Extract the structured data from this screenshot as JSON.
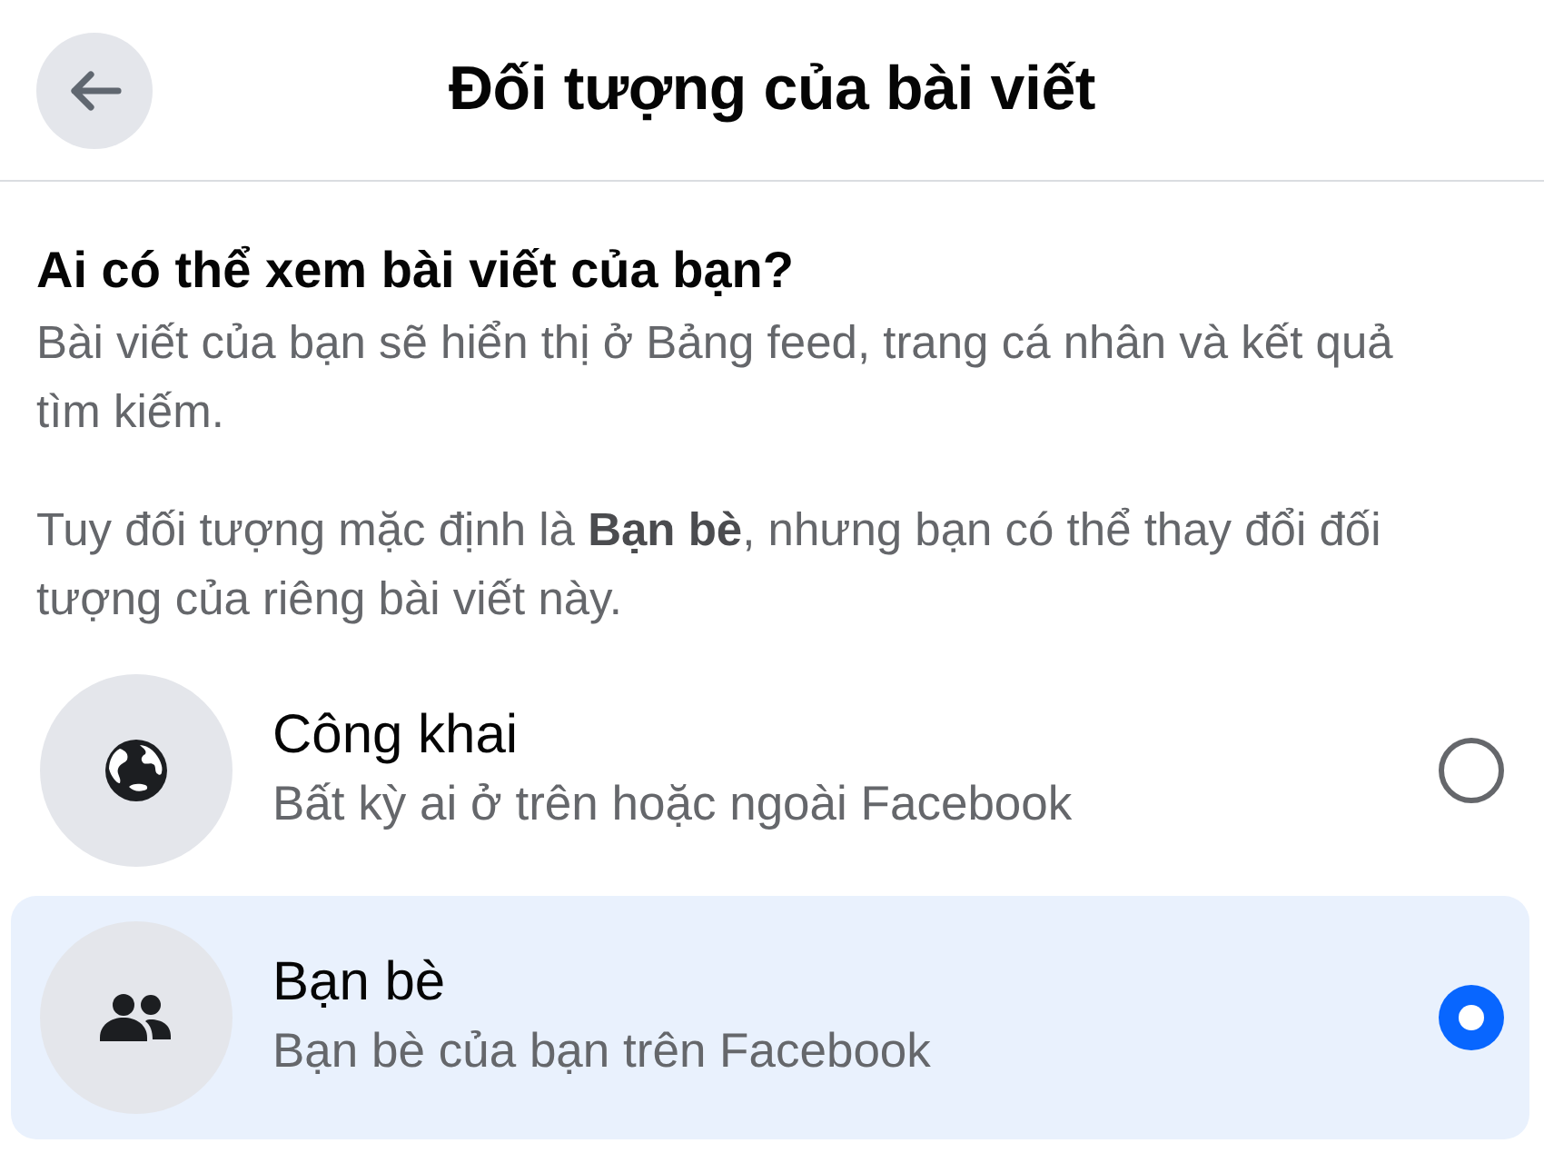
{
  "header": {
    "title": "Đối tượng của bài viết"
  },
  "intro": {
    "heading": "Ai có thể xem bài viết của bạn?",
    "paragraphs": [
      "Bài viết của bạn sẽ hiển thị ở Bảng feed, trang cá nhân và kết quả tìm kiếm.",
      "Tuy đối tượng mặc định là **Bạn bè**, nhưng bạn có thể thay đổi đối tượng của riêng bài viết này."
    ]
  },
  "options": [
    {
      "kind": "public",
      "title": "Công khai",
      "description": "Bất kỳ ai ở trên hoặc ngoài Facebook",
      "selected": false
    },
    {
      "kind": "friends",
      "title": "Bạn bè",
      "description": "Bạn bè của bạn trên Facebook",
      "selected": true
    }
  ]
}
